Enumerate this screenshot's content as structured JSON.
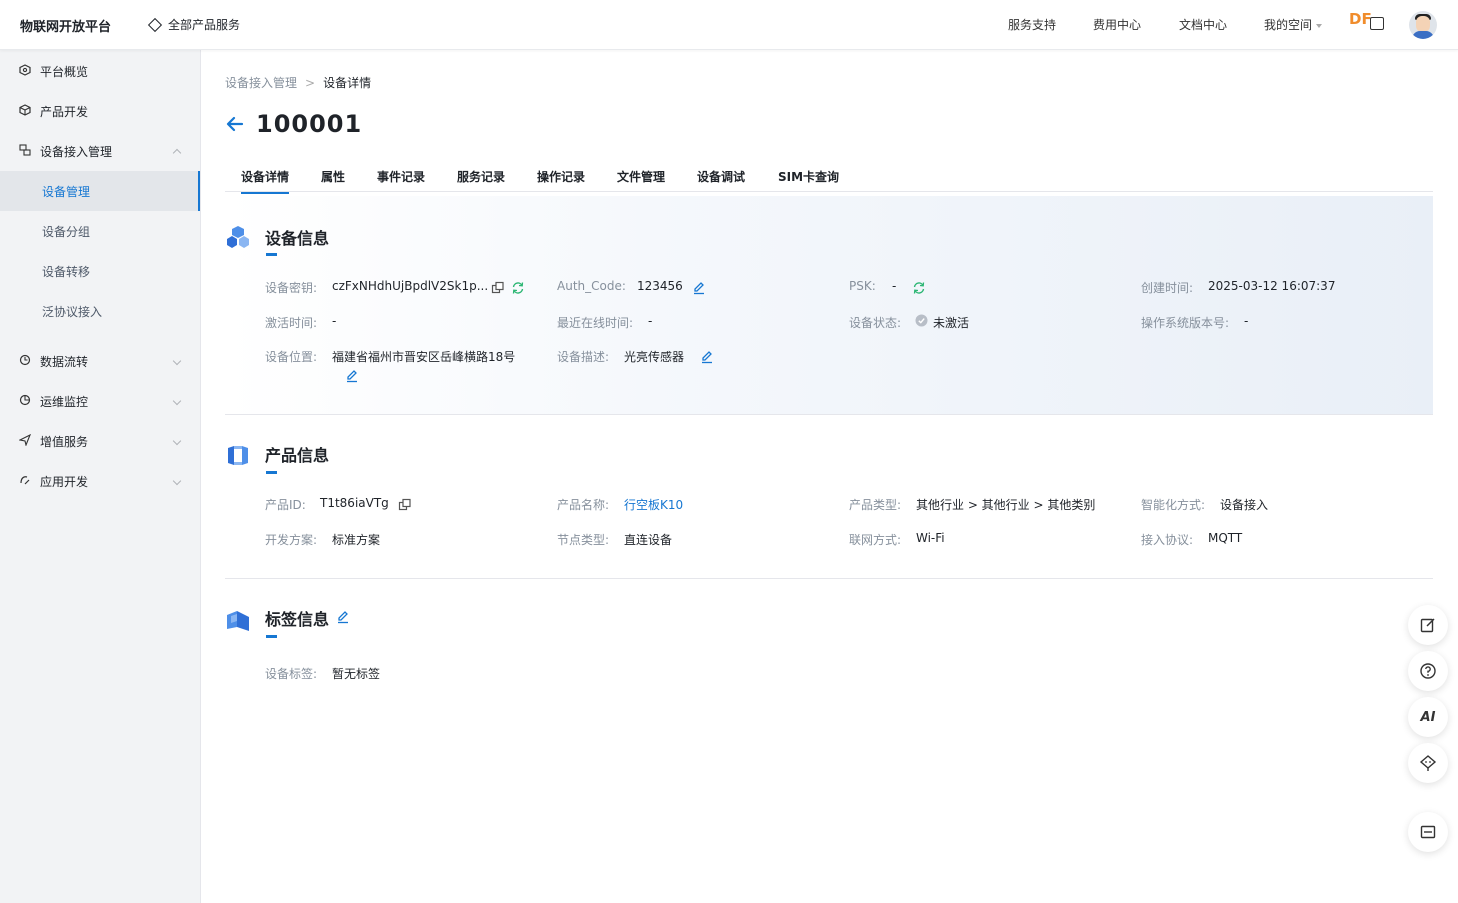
{
  "topbar": {
    "brand": "物联网开放平台",
    "all_products": "全部产品服务",
    "nav": [
      "服务支持",
      "费用中心",
      "文档中心",
      "我的空间"
    ],
    "logo_text": "DF"
  },
  "sidebar": {
    "items": [
      {
        "label": "平台概览",
        "icon": "overview-icon"
      },
      {
        "label": "产品开发",
        "icon": "cube-icon"
      },
      {
        "label": "设备接入管理",
        "icon": "device-access-icon"
      },
      {
        "label": "数据流转",
        "icon": "dataflow-icon"
      },
      {
        "label": "运维监控",
        "icon": "monitor-icon"
      },
      {
        "label": "增值服务",
        "icon": "send-icon"
      },
      {
        "label": "应用开发",
        "icon": "app-dev-icon"
      }
    ],
    "subitems": [
      "设备管理",
      "设备分组",
      "设备转移",
      "泛协议接入"
    ]
  },
  "breadcrumb": {
    "parent": "设备接入管理",
    "sep": ">",
    "current": "设备详情"
  },
  "device_id": "100001",
  "tabs": [
    "设备详情",
    "属性",
    "事件记录",
    "服务记录",
    "操作记录",
    "文件管理",
    "设备调试",
    "SIM卡查询"
  ],
  "device_info": {
    "title": "设备信息",
    "secret_label": "设备密钥:",
    "secret": "czFxNHdhUjBpdlV2Sk1p...",
    "auth_label": "Auth_Code:",
    "auth": "123456",
    "psk_label": "PSK:",
    "psk": "-",
    "created_label": "创建时间:",
    "created": "2025-03-12 16:07:37",
    "activated_label": "激活时间:",
    "activated": "-",
    "last_online_label": "最近在线时间:",
    "last_online": "-",
    "status_label": "设备状态:",
    "status": "未激活",
    "os_label": "操作系统版本号:",
    "os": "-",
    "location_label": "设备位置:",
    "location": "福建省福州市晋安区岳峰横路18号",
    "desc_label": "设备描述:",
    "desc": "光亮传感器"
  },
  "product_info": {
    "title": "产品信息",
    "pid_label": "产品ID:",
    "pid": "T1t86iaVTg",
    "name_label": "产品名称:",
    "name": "行空板K10",
    "type_label": "产品类型:",
    "type": "其他行业 > 其他行业 > 其他类别",
    "smart_label": "智能化方式:",
    "smart": "设备接入",
    "dev_label": "开发方案:",
    "dev": "标准方案",
    "node_label": "节点类型:",
    "node": "直连设备",
    "net_label": "联网方式:",
    "net": "Wi-Fi",
    "proto_label": "接入协议:",
    "proto": "MQTT"
  },
  "tag_info": {
    "title": "标签信息",
    "tags_label": "设备标签:",
    "tags": "暂无标签"
  },
  "float_buttons": [
    "edit-note-icon",
    "help-icon",
    "ai-icon",
    "service-icon",
    "collapse-icon"
  ],
  "float_ai_text": "AI",
  "colors": {
    "accent": "#1677d2",
    "refresh": "#2bb673"
  }
}
